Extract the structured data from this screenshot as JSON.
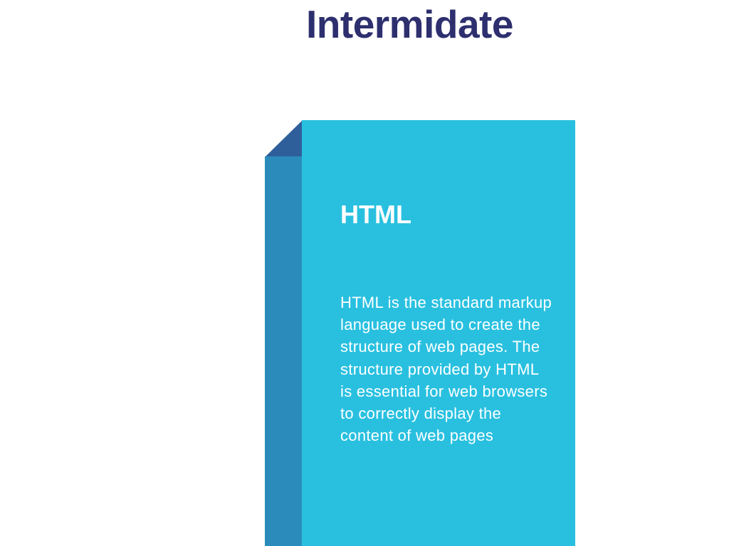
{
  "title": "Intermidate",
  "card": {
    "heading": "HTML",
    "body": "HTML is the standard markup language used to create the structure of web pages. The structure provided by HTML is essential for web browsers to correctly display the content of web pages"
  },
  "colors": {
    "title": "#2d2f6e",
    "card_front": "#29c0e0",
    "card_side": "#2b8cbc",
    "card_fold": "#2f5f9b",
    "card_text": "#ffffff"
  }
}
